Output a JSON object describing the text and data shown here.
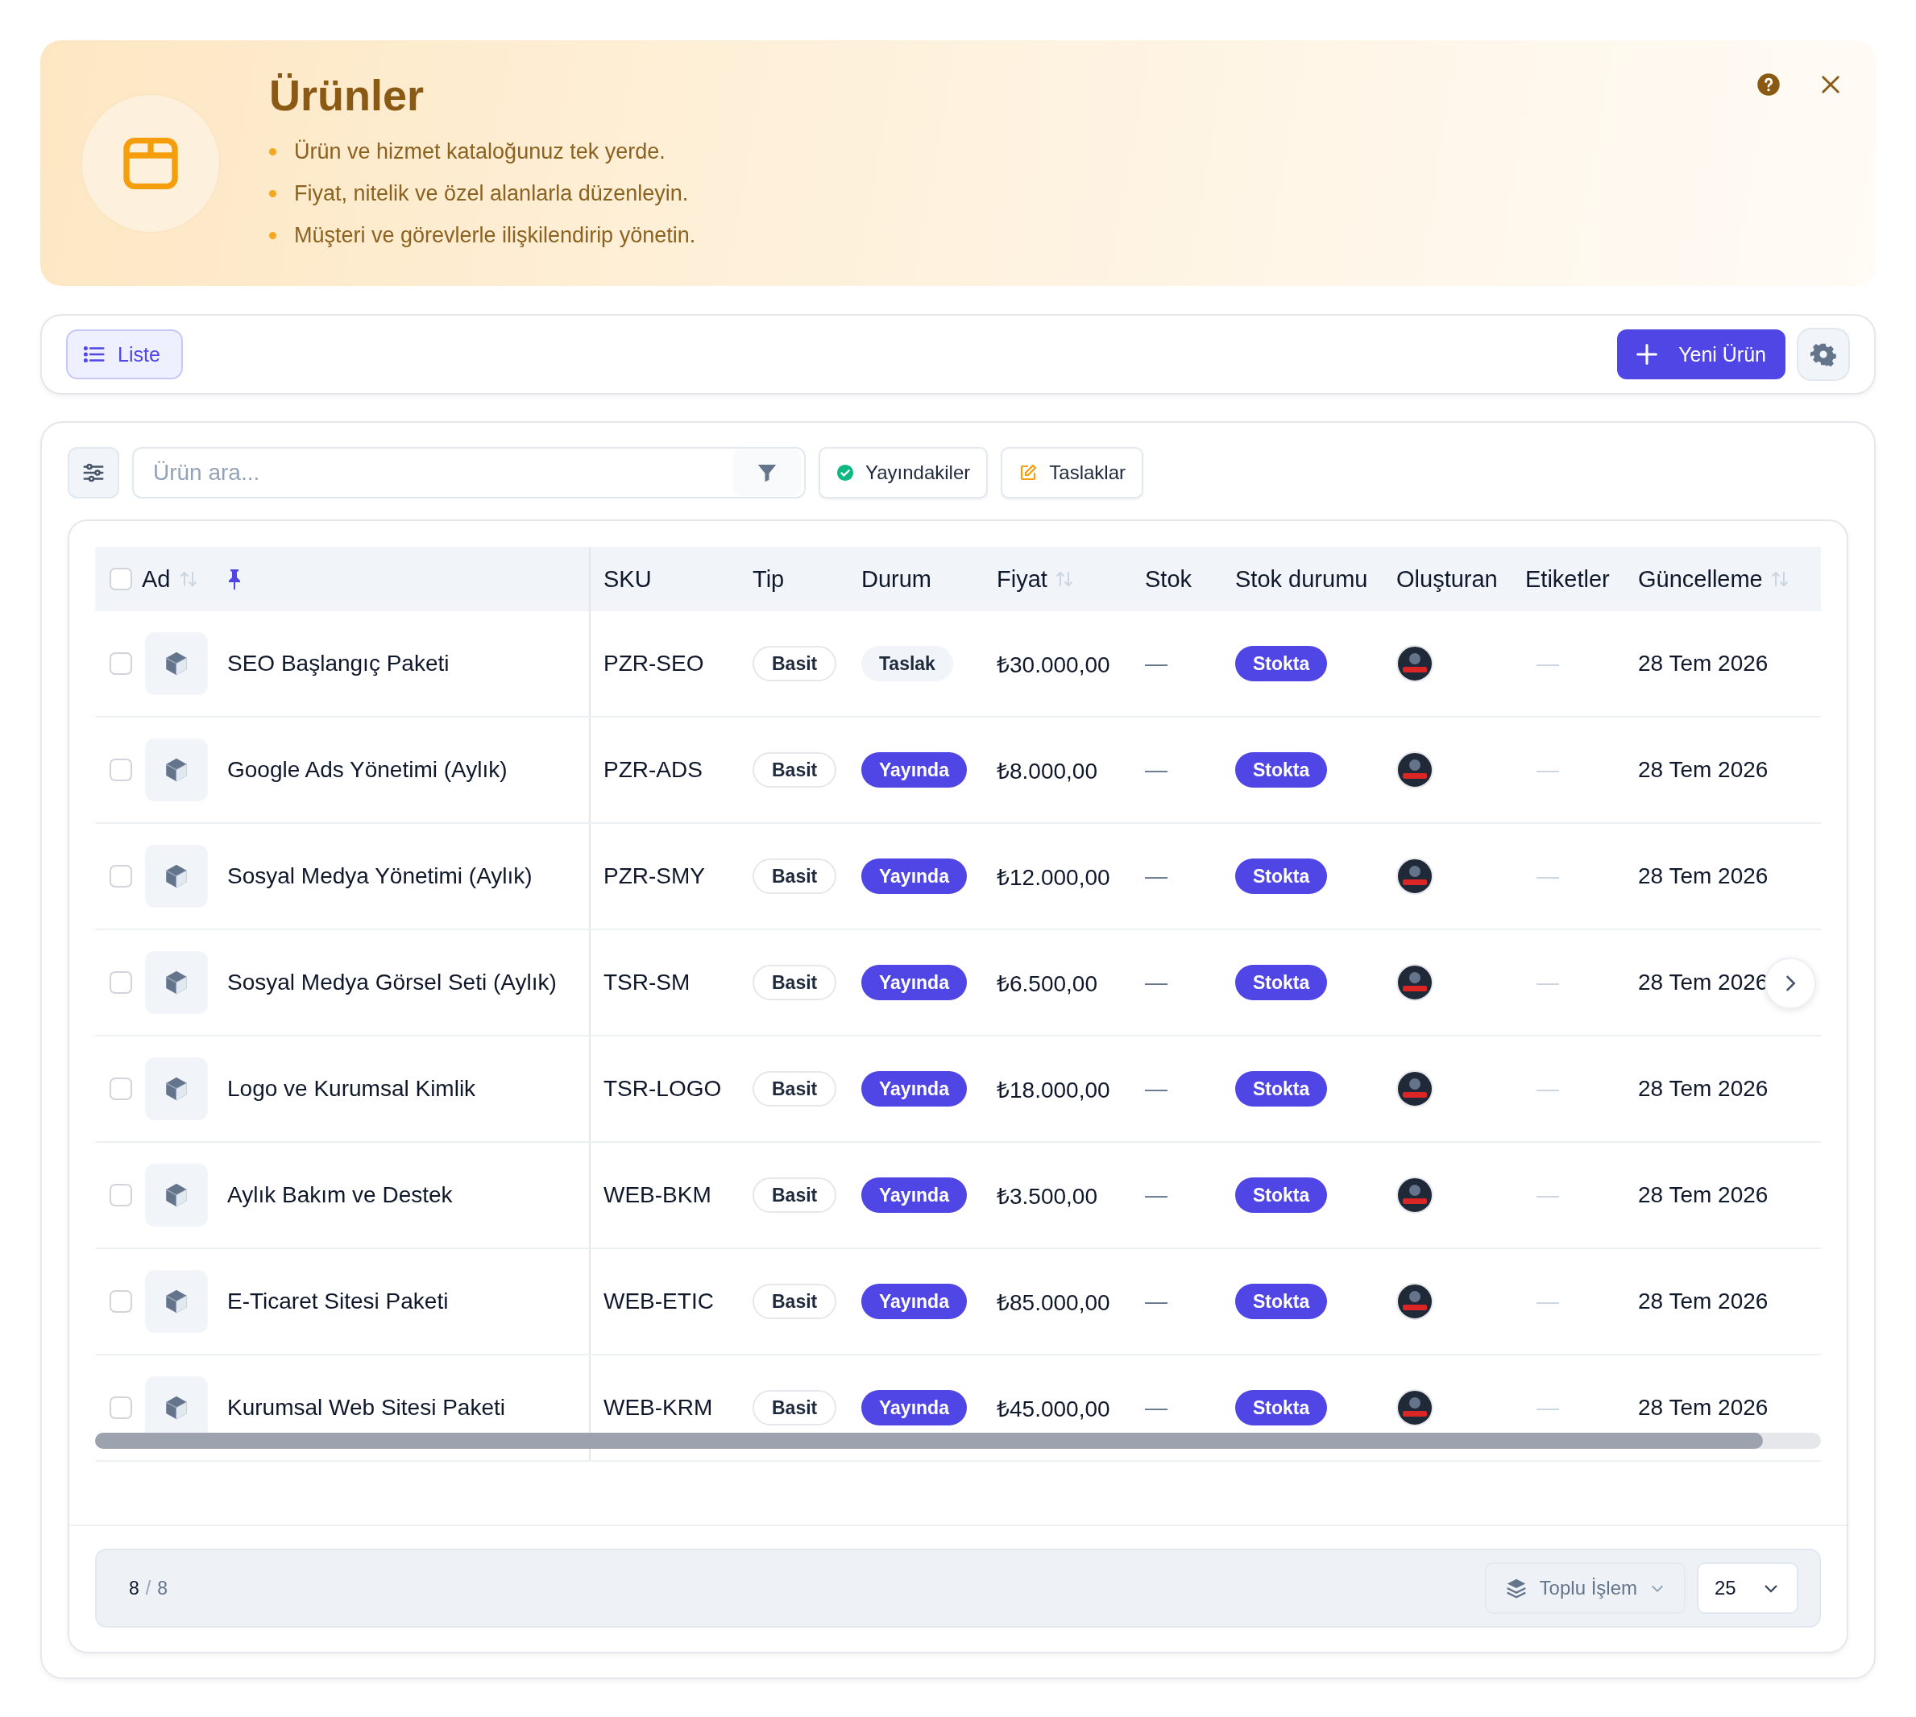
{
  "banner": {
    "title": "Ürünler",
    "bullets": [
      "Ürün ve hizmet kataloğunuz tek yerde.",
      "Fiyat, nitelik ve özel alanlarla düzenleyin.",
      "Müşteri ve görevlerle ilişkilendirip yönetin."
    ]
  },
  "toolbar": {
    "view_tab": {
      "label": "Liste",
      "selected": true
    },
    "new_button": "Yeni Ürün"
  },
  "filters": {
    "search": {
      "placeholder": "Ürün ara..."
    },
    "chips": [
      {
        "label": "Yayındakiler",
        "kind": "published"
      },
      {
        "label": "Taslaklar",
        "kind": "draft"
      }
    ]
  },
  "table": {
    "select_all": {
      "checked": false
    },
    "columns": [
      {
        "label": "Ad",
        "sortable": true,
        "pinned": true
      },
      {
        "label": "SKU",
        "sortable": false,
        "pinned": false
      },
      {
        "label": "Tip",
        "sortable": false,
        "pinned": false
      },
      {
        "label": "Durum",
        "sortable": false,
        "pinned": false
      },
      {
        "label": "Fiyat",
        "sortable": true,
        "pinned": false
      },
      {
        "label": "Stok",
        "sortable": false,
        "pinned": false
      },
      {
        "label": "Stok durumu",
        "sortable": false,
        "pinned": false
      },
      {
        "label": "Oluşturan",
        "sortable": false,
        "pinned": false
      },
      {
        "label": "Etiketler",
        "sortable": false,
        "pinned": false
      },
      {
        "label": "Güncelleme",
        "sortable": true,
        "pinned": false
      }
    ],
    "rows": [
      {
        "checked": false,
        "name": "SEO Başlangıç Paketi",
        "sku": "PZR-SEO",
        "type": "Basit",
        "status": {
          "label": "Taslak",
          "kind": "draft"
        },
        "price": "₺30.000,00",
        "stock": "—",
        "stock_status": "Stokta",
        "tags": "—",
        "updated": "28 Tem 2026"
      },
      {
        "checked": false,
        "name": "Google Ads Yönetimi (Aylık)",
        "sku": "PZR-ADS",
        "type": "Basit",
        "status": {
          "label": "Yayında",
          "kind": "published"
        },
        "price": "₺8.000,00",
        "stock": "—",
        "stock_status": "Stokta",
        "tags": "—",
        "updated": "28 Tem 2026"
      },
      {
        "checked": false,
        "name": "Sosyal Medya Yönetimi (Aylık)",
        "sku": "PZR-SMY",
        "type": "Basit",
        "status": {
          "label": "Yayında",
          "kind": "published"
        },
        "price": "₺12.000,00",
        "stock": "—",
        "stock_status": "Stokta",
        "tags": "—",
        "updated": "28 Tem 2026"
      },
      {
        "checked": false,
        "name": "Sosyal Medya Görsel Seti (Aylık)",
        "sku": "TSR-SM",
        "type": "Basit",
        "status": {
          "label": "Yayında",
          "kind": "published"
        },
        "price": "₺6.500,00",
        "stock": "—",
        "stock_status": "Stokta",
        "tags": "—",
        "updated": "28 Tem 2026"
      },
      {
        "checked": false,
        "name": "Logo ve Kurumsal Kimlik",
        "sku": "TSR-LOGO",
        "type": "Basit",
        "status": {
          "label": "Yayında",
          "kind": "published"
        },
        "price": "₺18.000,00",
        "stock": "—",
        "stock_status": "Stokta",
        "tags": "—",
        "updated": "28 Tem 2026"
      },
      {
        "checked": false,
        "name": "Aylık Bakım ve Destek",
        "sku": "WEB-BKM",
        "type": "Basit",
        "status": {
          "label": "Yayında",
          "kind": "published"
        },
        "price": "₺3.500,00",
        "stock": "—",
        "stock_status": "Stokta",
        "tags": "—",
        "updated": "28 Tem 2026"
      },
      {
        "checked": false,
        "name": "E-Ticaret Sitesi Paketi",
        "sku": "WEB-ETIC",
        "type": "Basit",
        "status": {
          "label": "Yayında",
          "kind": "published"
        },
        "price": "₺85.000,00",
        "stock": "—",
        "stock_status": "Stokta",
        "tags": "—",
        "updated": "28 Tem 2026"
      },
      {
        "checked": false,
        "name": "Kurumsal Web Sitesi Paketi",
        "sku": "WEB-KRM",
        "type": "Basit",
        "status": {
          "label": "Yayında",
          "kind": "published"
        },
        "price": "₺45.000,00",
        "stock": "—",
        "stock_status": "Stokta",
        "tags": "—",
        "updated": "28 Tem 2026"
      }
    ]
  },
  "footer": {
    "shown": "8",
    "separator": "/",
    "total": "8",
    "bulk_action": "Toplu İşlem",
    "page_size": "25"
  }
}
